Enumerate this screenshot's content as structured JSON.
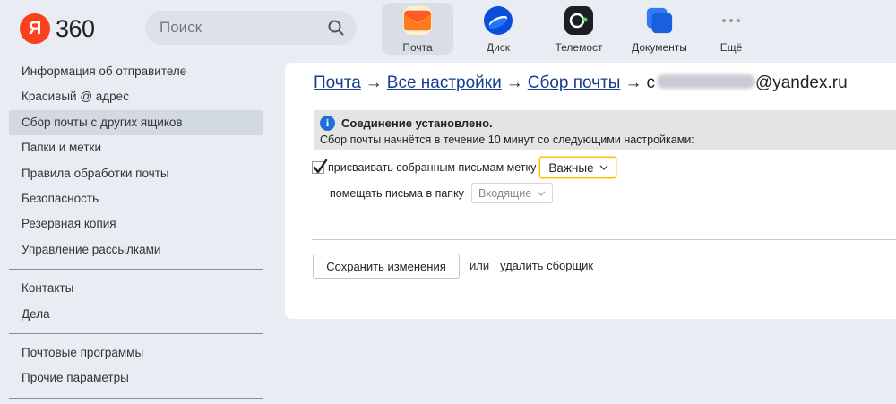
{
  "header": {
    "logo_letter": "Я",
    "logo_text": "360",
    "search_placeholder": "Поиск",
    "apps": [
      {
        "label": "Почта",
        "icon": "mail-envelope-icon",
        "active": true
      },
      {
        "label": "Диск",
        "icon": "disk-icon",
        "active": false
      },
      {
        "label": "Телемост",
        "icon": "telemost-icon",
        "active": false
      },
      {
        "label": "Документы",
        "icon": "documents-icon",
        "active": false
      },
      {
        "label": "Ещё",
        "icon": "more-dots-icon",
        "active": false
      }
    ]
  },
  "sidebar": {
    "group1": [
      {
        "label": "Информация об отправителе"
      },
      {
        "label": "Красивый @ адрес"
      },
      {
        "label": "Сбор почты с других ящиков",
        "active": true
      },
      {
        "label": "Папки и метки"
      },
      {
        "label": "Правила обработки почты"
      },
      {
        "label": "Безопасность"
      },
      {
        "label": "Резервная копия"
      },
      {
        "label": "Управление рассылками"
      }
    ],
    "group2": [
      {
        "label": "Контакты"
      },
      {
        "label": "Дела"
      }
    ],
    "group3": [
      {
        "label": "Почтовые программы"
      },
      {
        "label": "Прочие параметры"
      }
    ]
  },
  "main": {
    "breadcrumb": {
      "mail": "Почта",
      "all_settings": "Все настройки",
      "collector": "Сбор почты",
      "arrow": "→",
      "email_visible_prefix": "c",
      "email_suffix": "@yandex.ru"
    },
    "notice": {
      "title": "Соединение установлено.",
      "text": "Сбор почты начнётся в течение 10 минут со следующими настройками:"
    },
    "label_option": {
      "checked": true,
      "text": "присваивать собранным письмам метку",
      "value": "Важные"
    },
    "folder_option": {
      "text": "помещать письма в папку",
      "value": "Входящие"
    },
    "save_button": "Сохранить изменения",
    "or_text": "или",
    "delete_link": "удалить сборщик"
  },
  "colors": {
    "brand_red": "#fc3f1d",
    "link_blue": "#1a3d8f",
    "info_blue": "#1f6fd8",
    "highlight_yellow": "#f5c400",
    "page_bg": "#e9edf3"
  }
}
